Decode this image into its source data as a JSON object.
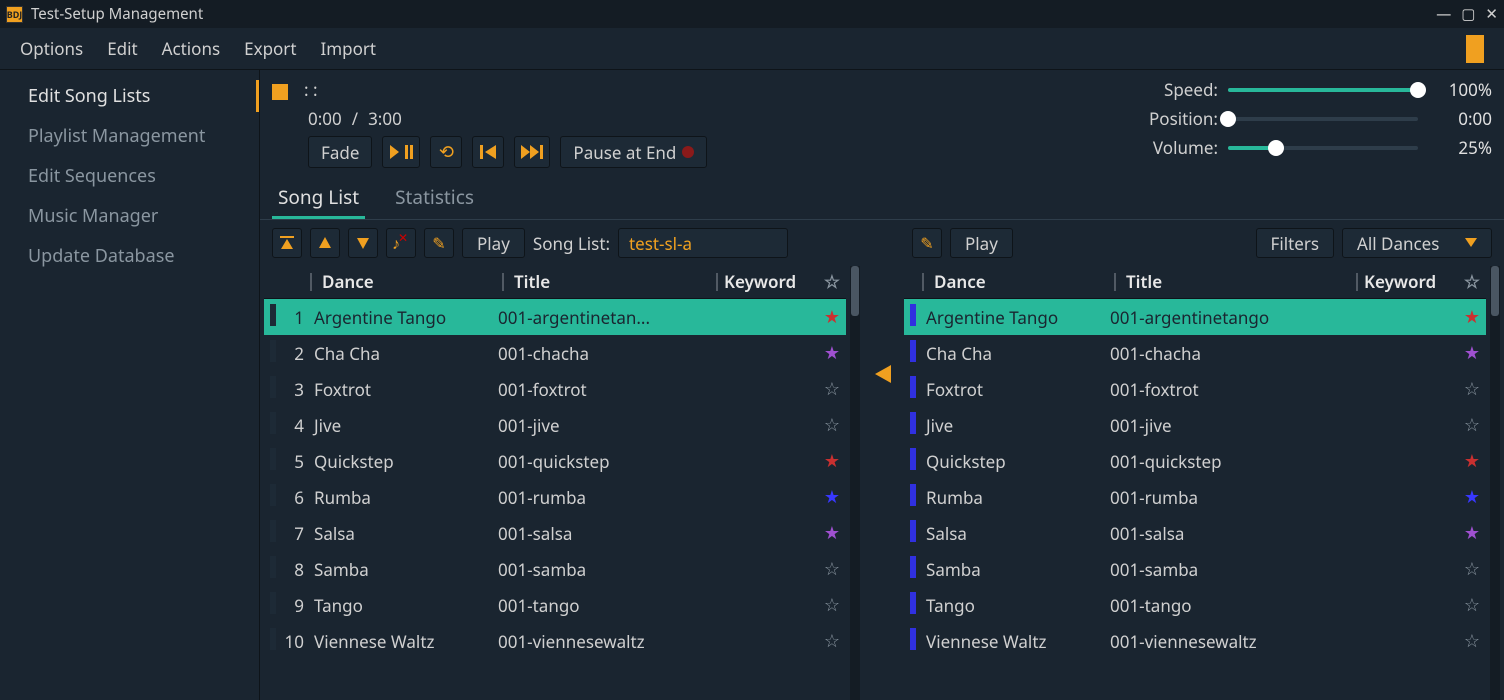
{
  "window": {
    "title": "Test-Setup Management"
  },
  "menu": {
    "options": "Options",
    "edit": "Edit",
    "actions": "Actions",
    "export": "Export",
    "import": "Import"
  },
  "sidebar": {
    "items": [
      {
        "label": "Edit Song Lists",
        "active": true
      },
      {
        "label": "Playlist Management",
        "active": false
      },
      {
        "label": "Edit Sequences",
        "active": false
      },
      {
        "label": "Music Manager",
        "active": false
      },
      {
        "label": "Update Database",
        "active": false
      }
    ]
  },
  "player": {
    "now": ":  :",
    "elapsed": "0:00",
    "sep": "/",
    "duration": "3:00",
    "fade": "Fade",
    "pause_end": "Pause at End",
    "speed_label": "Speed:",
    "speed_value": "100%",
    "speed_pct": 100,
    "position_label": "Position:",
    "position_value": "0:00",
    "position_pct": 0,
    "volume_label": "Volume:",
    "volume_value": "25%",
    "volume_pct": 25
  },
  "tabs": {
    "songlist": "Song List",
    "statistics": "Statistics"
  },
  "toolbar_left": {
    "play": "Play",
    "sl_label": "Song List:",
    "sl_value": "test-sl-a"
  },
  "toolbar_right": {
    "play": "Play",
    "filters": "Filters",
    "all_dances": "All Dances"
  },
  "headers": {
    "dance": "Dance",
    "title": "Title",
    "keyword": "Keyword"
  },
  "rows_left": [
    {
      "idx": "1",
      "dance": "Argentine Tango",
      "title": "001-argentinetan...",
      "star": "red",
      "sel": true
    },
    {
      "idx": "2",
      "dance": "Cha Cha",
      "title": "001-chacha",
      "star": "purple"
    },
    {
      "idx": "3",
      "dance": "Foxtrot",
      "title": "001-foxtrot",
      "star": "none"
    },
    {
      "idx": "4",
      "dance": "Jive",
      "title": "001-jive",
      "star": "none"
    },
    {
      "idx": "5",
      "dance": "Quickstep",
      "title": "001-quickstep",
      "star": "red"
    },
    {
      "idx": "6",
      "dance": "Rumba",
      "title": "001-rumba",
      "star": "blue"
    },
    {
      "idx": "7",
      "dance": "Salsa",
      "title": "001-salsa",
      "star": "purple"
    },
    {
      "idx": "8",
      "dance": "Samba",
      "title": "001-samba",
      "star": "none"
    },
    {
      "idx": "9",
      "dance": "Tango",
      "title": "001-tango",
      "star": "none"
    },
    {
      "idx": "10",
      "dance": "Viennese Waltz",
      "title": "001-viennesewaltz",
      "star": "none"
    }
  ],
  "rows_right": [
    {
      "dance": "Argentine Tango",
      "title": "001-argentinetango",
      "star": "red",
      "sel": true
    },
    {
      "dance": "Cha Cha",
      "title": "001-chacha",
      "star": "purple"
    },
    {
      "dance": "Foxtrot",
      "title": "001-foxtrot",
      "star": "none"
    },
    {
      "dance": "Jive",
      "title": "001-jive",
      "star": "none"
    },
    {
      "dance": "Quickstep",
      "title": "001-quickstep",
      "star": "red"
    },
    {
      "dance": "Rumba",
      "title": "001-rumba",
      "star": "blue"
    },
    {
      "dance": "Salsa",
      "title": "001-salsa",
      "star": "purple"
    },
    {
      "dance": "Samba",
      "title": "001-samba",
      "star": "none"
    },
    {
      "dance": "Tango",
      "title": "001-tango",
      "star": "none"
    },
    {
      "dance": "Viennese Waltz",
      "title": "001-viennesewaltz",
      "star": "none"
    }
  ]
}
